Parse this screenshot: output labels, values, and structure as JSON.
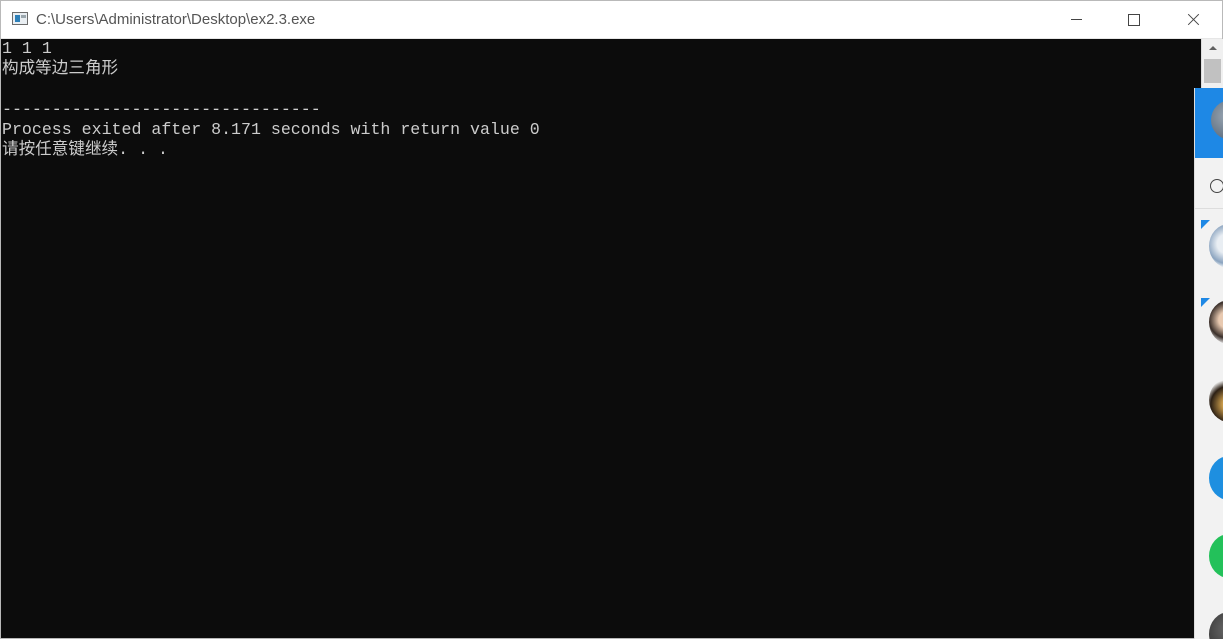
{
  "window": {
    "title": "C:\\Users\\Administrator\\Desktop\\ex2.3.exe",
    "icon": "console-app-icon",
    "controls": {
      "minimize_icon": "minimize-icon",
      "maximize_icon": "maximize-icon",
      "close_icon": "close-icon"
    }
  },
  "console": {
    "background": "#0c0c0c",
    "foreground": "#cccccc",
    "lines": [
      "1 1 1",
      "构成等边三角形",
      "",
      "--------------------------------",
      "Process exited after 8.171 seconds with return value 0",
      "请按任意键继续. . ."
    ]
  },
  "side_panel": {
    "accent": "#1e88e5",
    "icons": [
      "avatar",
      "check-circle-icon",
      "avatar",
      "avatar",
      "avatar",
      "avatar",
      "app-icon"
    ]
  }
}
